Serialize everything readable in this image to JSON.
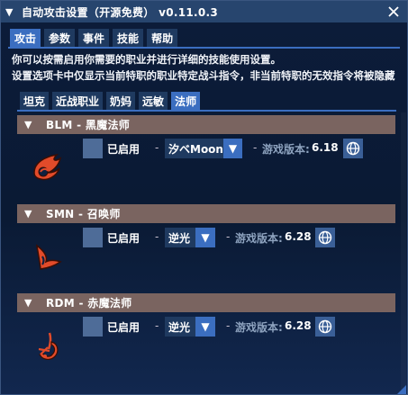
{
  "window": {
    "title": "自动攻击设置（开源免费） v0.11.0.3",
    "collapse_icon": "collapse-triangle-icon",
    "close_icon": "close-icon"
  },
  "tabs": [
    {
      "label": "攻击",
      "active": true
    },
    {
      "label": "参数",
      "active": false
    },
    {
      "label": "事件",
      "active": false
    },
    {
      "label": "技能",
      "active": false
    },
    {
      "label": "帮助",
      "active": false
    }
  ],
  "description": {
    "line1": "你可以按需启用你需要的职业并进行详细的技能使用设置。",
    "line2": "设置选项卡中仅显示当前特职的职业特定战斗指令，非当前特职的无效指令将被隐藏"
  },
  "role_tabs": [
    {
      "label": "坦克",
      "active": false
    },
    {
      "label": "近战职业",
      "active": false
    },
    {
      "label": "奶妈",
      "active": false
    },
    {
      "label": "远敏",
      "active": false
    },
    {
      "label": "法师",
      "active": true
    }
  ],
  "jobs": [
    {
      "header": "BLM - 黑魔法师",
      "icon": "blm-job-icon",
      "enabled_label": "已启用",
      "enabled": false,
      "dash": "-",
      "rotation": "汐ベMoon",
      "version_label": "游戏版本:",
      "version": "6.18",
      "color": "#e24b2a"
    },
    {
      "header": "SMN - 召唤师",
      "icon": "smn-job-icon",
      "enabled_label": "已启用",
      "enabled": false,
      "dash": "-",
      "rotation": "逆光",
      "version_label": "游戏版本:",
      "version": "6.28",
      "color": "#e24b2a"
    },
    {
      "header": "RDM - 赤魔法师",
      "icon": "rdm-job-icon",
      "enabled_label": "已启用",
      "enabled": false,
      "dash": "-",
      "rotation": "逆光",
      "version_label": "游戏版本:",
      "version": "6.28",
      "color": "#e24b2a"
    }
  ],
  "colors": {
    "title_bar": "#27456e",
    "tab_active": "#3b6ec0",
    "tab_inactive": "#1f3a60",
    "job_header": "#7a6460",
    "checkbox": "#4e6c98",
    "job_icon": "#e24b2a"
  }
}
